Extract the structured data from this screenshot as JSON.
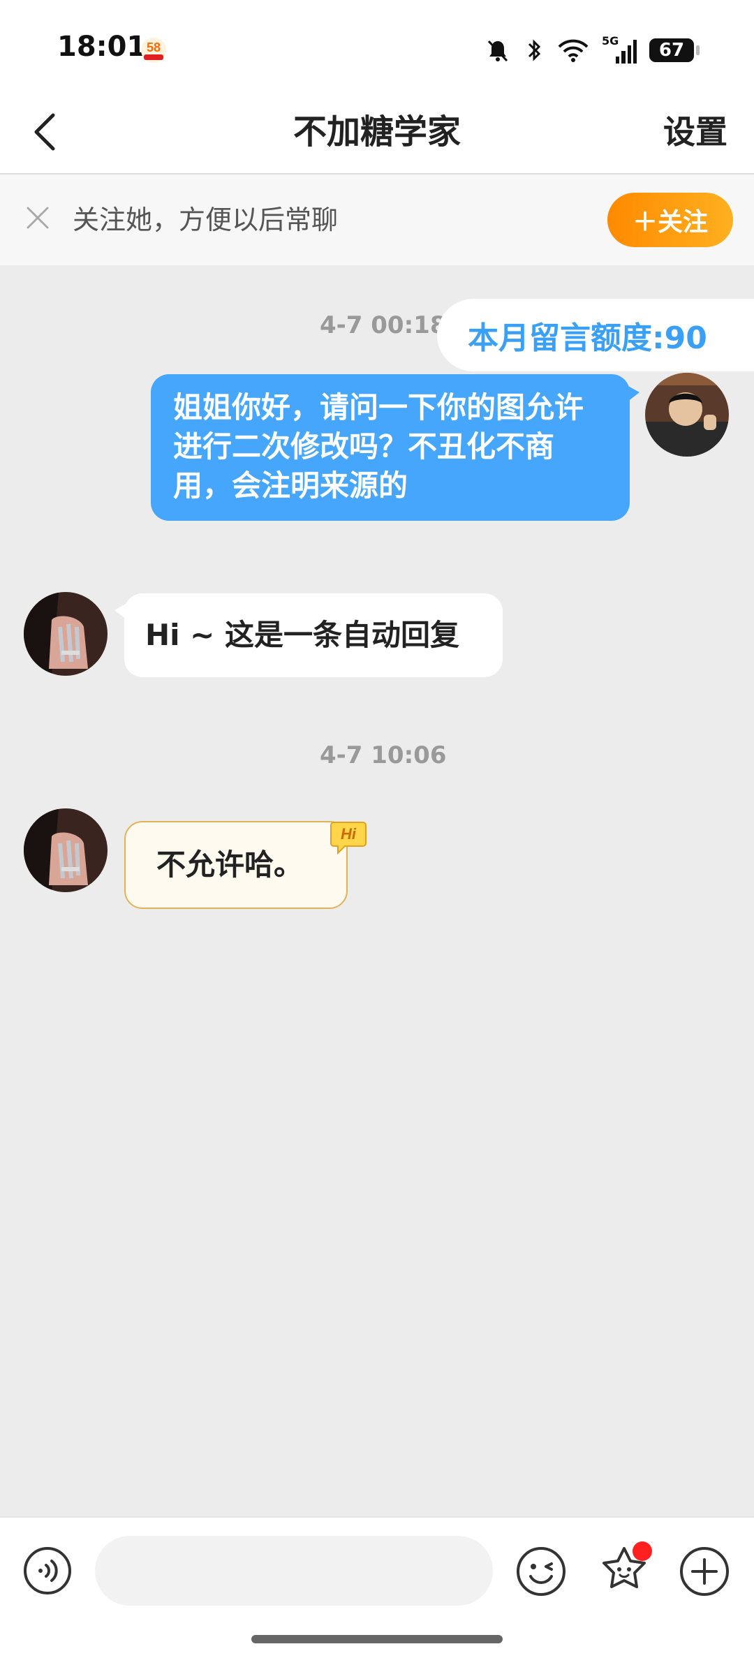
{
  "status_bar": {
    "time": "18:01",
    "network": "5G",
    "battery": "67"
  },
  "header": {
    "title": "不加糖学家",
    "settings": "设置"
  },
  "follow_banner": {
    "text": "关注她，方便以后常聊",
    "button": "＋关注"
  },
  "chat": {
    "quota": "本月留言额度:90",
    "messages": [
      {
        "timestamp": "4-7 00:18",
        "side": "right",
        "text": "姐姐你好，请问一下你的图允许进行二次修改吗？不丑化不商用，会注明来源的"
      },
      {
        "side": "left",
        "text": "Hi ~ 这是一条自动回复"
      },
      {
        "timestamp": "4-7 10:06",
        "side": "left",
        "text": "不允许哈。",
        "badge": "Hi"
      }
    ]
  },
  "colors": {
    "accent_blue": "#45a6fb",
    "follow_orange": "#ff9a10",
    "reply_border": "#e3b257"
  }
}
